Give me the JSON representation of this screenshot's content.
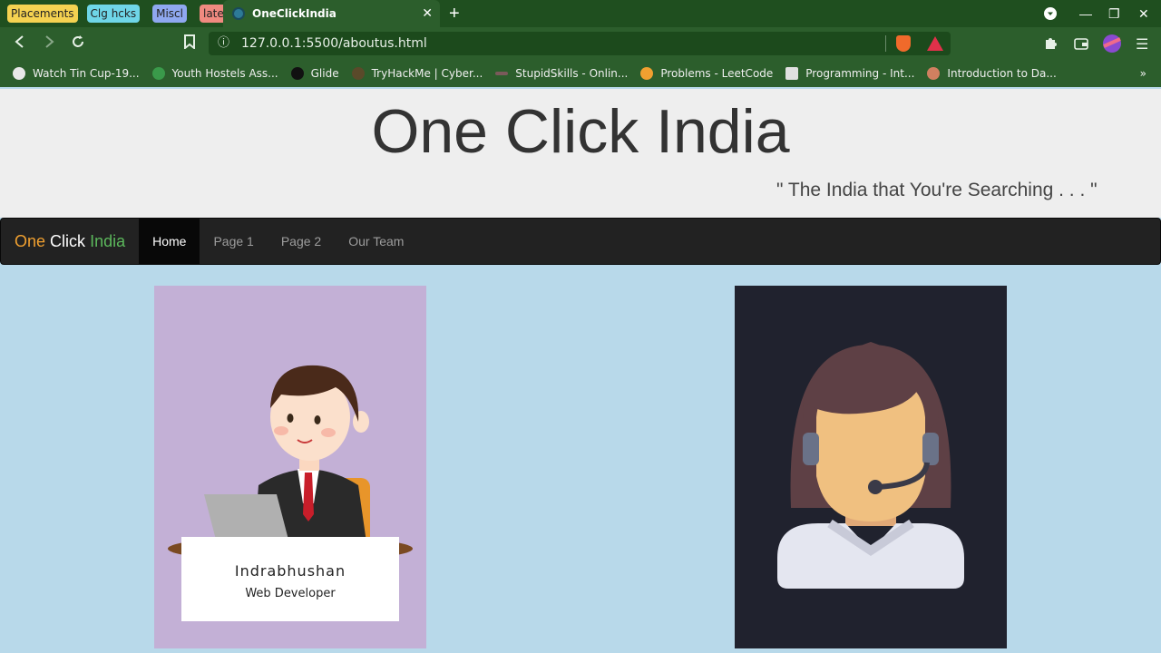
{
  "browser": {
    "tab_groups": [
      {
        "label": "Placements",
        "color": "#f5d251"
      },
      {
        "label": "Clg hcks",
        "color": "#6fd6e8"
      },
      {
        "label": "Miscl",
        "color": "#8fa8f0"
      },
      {
        "label": "latest",
        "color": "#f08a80"
      }
    ],
    "active_tab_title": "OneClickIndia",
    "url": "127.0.0.1:5500/aboutus.html",
    "bookmarks": [
      {
        "label": "Watch Tin Cup-19...",
        "icon": "globe-icon"
      },
      {
        "label": "Youth Hostels Ass...",
        "icon": "hostel-icon"
      },
      {
        "label": "Glide",
        "icon": "glide-icon"
      },
      {
        "label": "TryHackMe | Cyber...",
        "icon": "tryhackme-icon"
      },
      {
        "label": "StupidSkills - Onlin...",
        "icon": "stupidskills-icon"
      },
      {
        "label": "Problems - LeetCode",
        "icon": "leetcode-icon"
      },
      {
        "label": "Programming - Int...",
        "icon": "programming-icon"
      },
      {
        "label": "Introduction to Da...",
        "icon": "avatar-icon"
      }
    ]
  },
  "site": {
    "title": "One Click India",
    "tagline": "\" The India that You're Searching . . . \"",
    "brand": {
      "one": "One",
      "click": "Click",
      "india": "India"
    },
    "nav": [
      "Home",
      "Page 1",
      "Page 2",
      "Our Team"
    ],
    "active_nav": "Home"
  },
  "team": [
    {
      "name": "Indrabhushan",
      "role": "Web Developer"
    }
  ],
  "colors": {
    "page_background": "#b8d9ea",
    "header_background": "#eeeeee",
    "navbar_background": "#222222",
    "card1_background": "#c3b0d6",
    "card2_background": "#20222e",
    "brand_one": "#f0a030",
    "brand_india": "#5cb85c"
  }
}
